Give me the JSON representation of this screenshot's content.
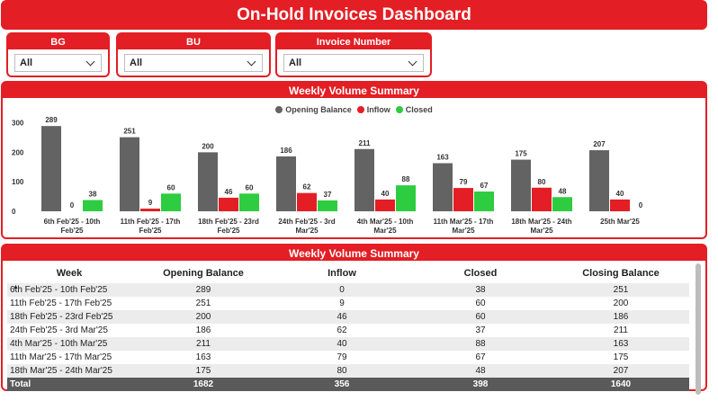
{
  "header": {
    "title": "On-Hold Invoices Dashboard"
  },
  "slicers": [
    {
      "label": "BG",
      "value": "All"
    },
    {
      "label": "BU",
      "value": "All"
    },
    {
      "label": "Invoice Number",
      "value": "All"
    }
  ],
  "colors": {
    "accent": "#e31e24",
    "opening": "#636363",
    "inflow": "#e31e24",
    "closed": "#2ecc40"
  },
  "chart_panel": {
    "title": "Weekly Volume Summary"
  },
  "chart_data": {
    "type": "bar",
    "title": "Weekly Volume Summary",
    "categories": [
      [
        "6th Feb'25 - 10th",
        "Feb'25"
      ],
      [
        "11th Feb'25 - 17th",
        "Feb'25"
      ],
      [
        "18th Feb'25 - 23rd",
        "Feb'25"
      ],
      [
        "24th Feb'25 - 3rd",
        "Mar'25"
      ],
      [
        "4th Mar'25 - 10th",
        "Mar'25"
      ],
      [
        "11th Mar'25 - 17th",
        "Mar'25"
      ],
      [
        "18th Mar'25 - 24th",
        "Mar'25"
      ],
      [
        "25th Mar'25",
        ""
      ]
    ],
    "series": [
      {
        "name": "Opening Balance",
        "color": "#636363",
        "values": [
          289,
          251,
          200,
          186,
          211,
          163,
          175,
          207
        ]
      },
      {
        "name": "Inflow",
        "color": "#e31e24",
        "values": [
          0,
          9,
          46,
          62,
          40,
          79,
          80,
          40
        ]
      },
      {
        "name": "Closed",
        "color": "#2ecc40",
        "values": [
          38,
          60,
          60,
          37,
          88,
          67,
          48,
          0
        ]
      }
    ],
    "yticks": [
      0,
      100,
      200,
      300
    ],
    "ylim": [
      0,
      320
    ],
    "legend": "top-center",
    "grid": false
  },
  "table_panel": {
    "title": "Weekly Volume Summary",
    "columns": [
      "Week",
      "Opening Balance",
      "Inflow",
      "Closed",
      "Closing Balance"
    ],
    "rows": [
      [
        "6th Feb'25 - 10th Feb'25",
        "289",
        "0",
        "38",
        "251"
      ],
      [
        "11th Feb'25 - 17th Feb'25",
        "251",
        "9",
        "60",
        "200"
      ],
      [
        "18th Feb'25 - 23rd Feb'25",
        "200",
        "46",
        "60",
        "186"
      ],
      [
        "24th Feb'25 - 3rd Mar'25",
        "186",
        "62",
        "37",
        "211"
      ],
      [
        "4th Mar'25 - 10th Mar'25",
        "211",
        "40",
        "88",
        "163"
      ],
      [
        "11th Mar'25 - 17th Mar'25",
        "163",
        "79",
        "67",
        "175"
      ],
      [
        "18th Mar'25 - 24th Mar'25",
        "175",
        "80",
        "48",
        "207"
      ]
    ],
    "total": [
      "Total",
      "1682",
      "356",
      "398",
      "1640"
    ]
  }
}
